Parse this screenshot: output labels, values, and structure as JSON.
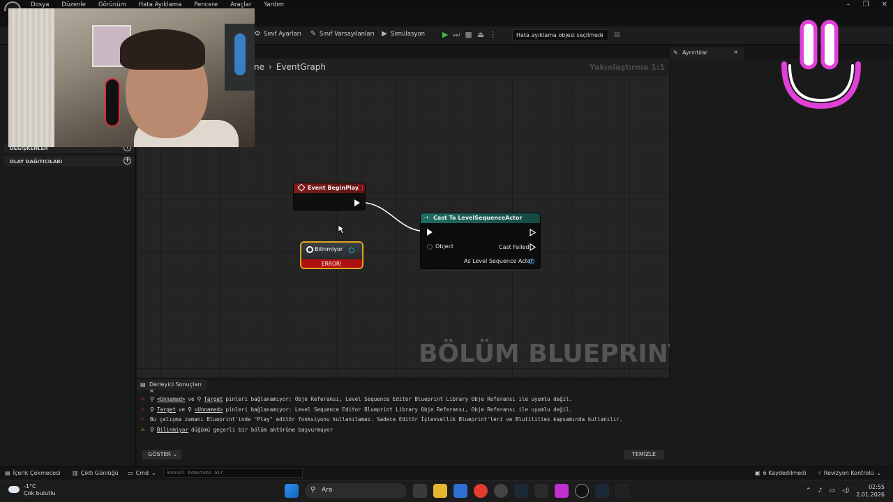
{
  "menu": {
    "items": [
      "Dosya",
      "Düzenle",
      "Görünüm",
      "Hata Ayıklama",
      "Pencere",
      "Araçlar",
      "Yardım"
    ],
    "window_controls": [
      "–",
      "❐",
      "✕"
    ]
  },
  "toolbar": {
    "class_settings": "Sınıf Ayarları",
    "class_defaults": "Sınıf Varsayılanları",
    "simulation": "Simülasyon",
    "debug_object": "Hata ayıklama objesi seçilmedi"
  },
  "left_panel": {
    "sections": [
      {
        "label": "DEĞİŞKENLER"
      },
      {
        "label": "OLAY DAĞITICILARI"
      }
    ]
  },
  "details": {
    "tab_label": "Ayrıntılar"
  },
  "graph": {
    "breadcrumb_parent": "cene",
    "breadcrumb_current": "EventGraph",
    "zoom": "Yakınlaştırma 1:1",
    "watermark": "BÖLÜM BLUEPRINT'İ",
    "nodes": {
      "begin_play": {
        "title": "Event BeginPlay"
      },
      "cast": {
        "title": "Cast To LevelSequenceActor",
        "object_pin": "Object",
        "cast_failed": "Cast Failed",
        "as_actor": "As Level Sequence Actor"
      },
      "unknown": {
        "title": "Bilinmiyor",
        "error": "ERROR!"
      }
    }
  },
  "results": {
    "tab_label": "Derleyici Sonuçları",
    "messages": [
      {
        "level": "error",
        "a": "<Unnamed>",
        "mid": "ve",
        "b": "Target",
        "text": "pinleri bağlanamıyor: Obje Referansı, Level Sequence Editor Blueprint Library Obje Referansı ile uyumlu değil."
      },
      {
        "level": "error",
        "a": "Target",
        "mid": "ve",
        "b": "<Unnamed>",
        "text": "pinleri bağlanamıyor: Level Sequence Editor Blueprint Library Obje Referansı, Obje Referansı ile uyumlu değil."
      },
      {
        "level": "error",
        "text": "Bu çalışma zamanı Blueprint'inde \"Play\" editör fonksiyonu kullanılamaz. Sadece Editör İşlevsellik Blueprint'leri ve Blutilities kapsamında kullanılır."
      },
      {
        "level": "warning",
        "a": "Bilinmiyor",
        "text": "düğümü geçerli bir bölüm aktörüne başvurmuyor"
      }
    ],
    "show_label": "GÖSTER",
    "clear_label": "TEMİZLE"
  },
  "statusbar": {
    "content_drawer": "İçerik Çekmecesi",
    "output_log": "Çıktı Günlüğü",
    "cmd": "Cmd",
    "console_placeholder": "Konsol Komutunu Gir",
    "unsaved": "6 Kaydedilmedi",
    "revision": "Revizyon Kontrolü"
  },
  "taskbar": {
    "temperature": "-1°C",
    "weather": "Çok bulutlu",
    "search": "Ara",
    "time": "02:55",
    "date": "2.01.2026"
  },
  "colors": {
    "event_header": "#7e1b1b",
    "cast_header": "#1f6b63",
    "error_red": "#b01010",
    "node_outline": "#e0a520",
    "smiley": "#e040d8"
  }
}
